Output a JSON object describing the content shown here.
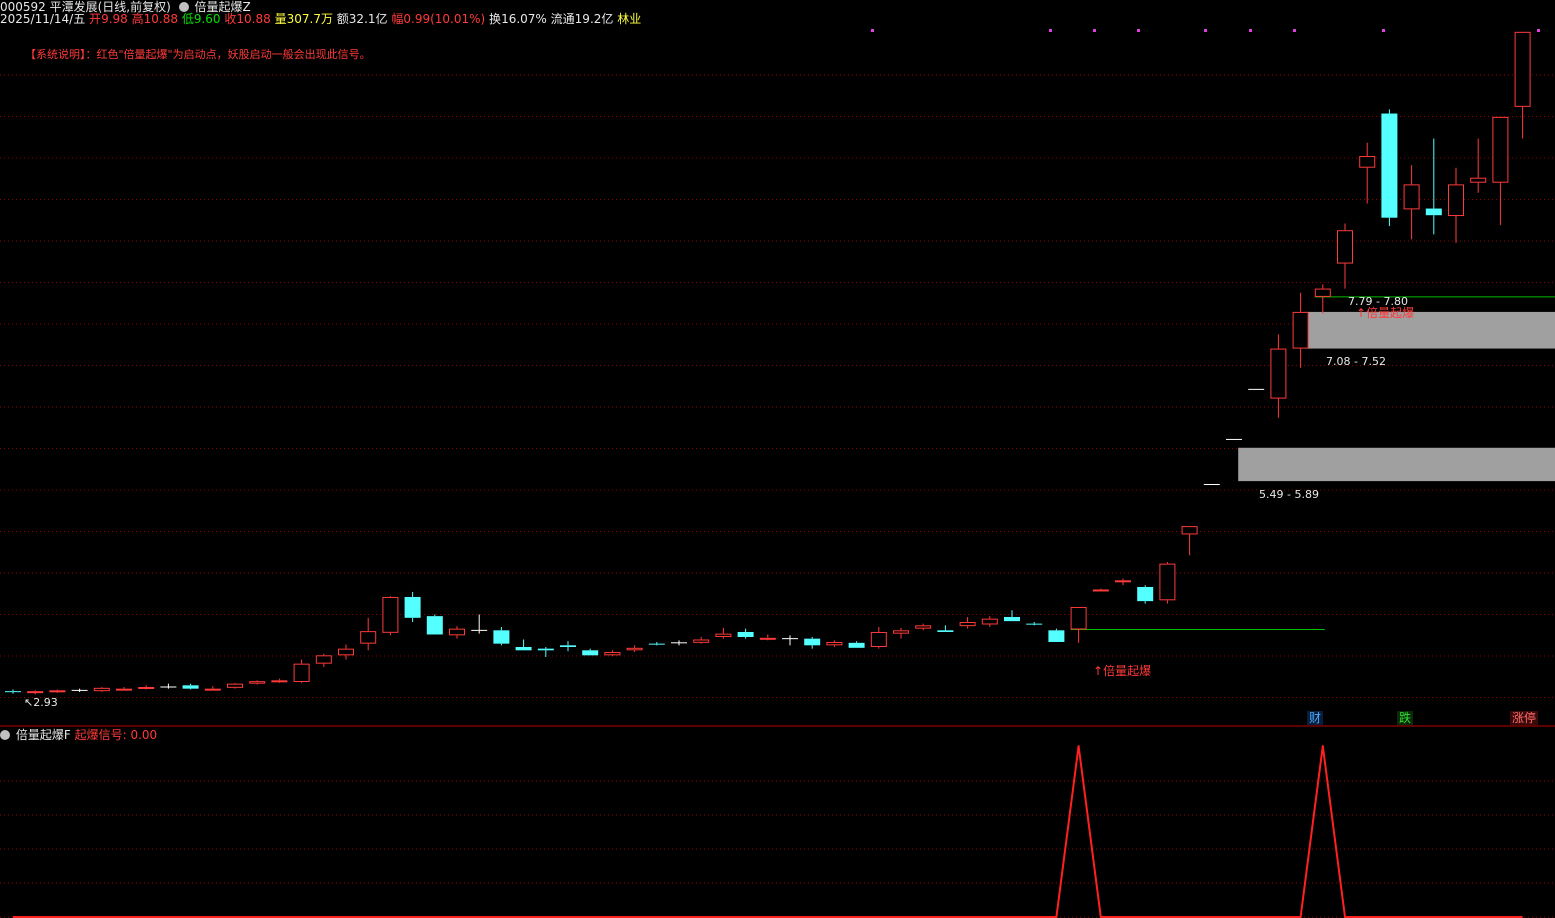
{
  "header": {
    "code_title": "000592 平潭发展(日线,前复权)",
    "indicator_name": "倍量起爆Z",
    "date": "2025/11/14/五",
    "open_label": "开",
    "open": "9.98",
    "high_label": "高",
    "high": "10.88",
    "low_label": "低",
    "low": "9.60",
    "close_label": "收",
    "close": "10.88",
    "vol_label": "量",
    "vol": "307.7万",
    "amt_label": "额",
    "amt": "32.1亿",
    "chg_label": "幅",
    "chg": "0.99(10.01%)",
    "turn_label": "换",
    "turn": "16.07%",
    "float_label": "流通",
    "float": "19.2亿",
    "industry": "林业"
  },
  "note": "【系统说明】：红色\"倍量起爆\"为启动点，妖股启动一般会出现此信号。",
  "labels": {
    "low_price": "2.93",
    "signal_a": "倍量起爆",
    "signal_b": "倍量起爆",
    "zone_top": "7.79 - 7.80",
    "zone_mid": "7.08 - 7.52",
    "zone_low": "5.49 - 5.89",
    "badge_cai": "财",
    "badge_die": "跌",
    "badge_zhang": "涨停"
  },
  "sub": {
    "name": "倍量起爆F",
    "series_label": "起爆信号:",
    "series_value": "0.00"
  },
  "colors": {
    "up": "#ff3a3a",
    "down": "#54ffff",
    "grid": "#8b0000",
    "zone": "#a0a0a0",
    "support": "#00c000"
  },
  "chart_data": [
    {
      "type": "candlestick",
      "candles": [
        [
          2.97,
          2.99,
          2.94,
          2.96
        ],
        [
          2.95,
          2.98,
          2.93,
          2.97
        ],
        [
          2.97,
          2.99,
          2.95,
          2.98
        ],
        [
          2.98,
          3.0,
          2.96,
          2.98
        ],
        [
          2.97,
          3.02,
          2.96,
          3.01
        ],
        [
          2.99,
          3.02,
          2.98,
          3.0
        ],
        [
          3.0,
          3.04,
          2.99,
          3.02
        ],
        [
          3.02,
          3.06,
          3.0,
          3.02
        ],
        [
          3.04,
          3.06,
          2.99,
          3.0
        ],
        [
          2.99,
          3.03,
          2.98,
          3.0
        ],
        [
          3.01,
          3.07,
          3.0,
          3.06
        ],
        [
          3.06,
          3.1,
          3.05,
          3.09
        ],
        [
          3.09,
          3.12,
          3.07,
          3.1
        ],
        [
          3.08,
          3.35,
          3.07,
          3.3
        ],
        [
          3.3,
          3.42,
          3.26,
          3.4
        ],
        [
          3.4,
          3.53,
          3.35,
          3.48
        ],
        [
          3.54,
          3.85,
          3.46,
          3.69
        ],
        [
          3.67,
          4.11,
          3.64,
          4.1
        ],
        [
          4.1,
          4.16,
          3.8,
          3.85
        ],
        [
          3.87,
          3.89,
          3.65,
          3.65
        ],
        [
          3.64,
          3.75,
          3.6,
          3.72
        ],
        [
          3.7,
          3.89,
          3.66,
          3.7
        ],
        [
          3.7,
          3.74,
          3.52,
          3.54
        ],
        [
          3.5,
          3.59,
          3.48,
          3.46
        ],
        [
          3.48,
          3.5,
          3.38,
          3.46
        ],
        [
          3.52,
          3.57,
          3.45,
          3.5
        ],
        [
          3.46,
          3.48,
          3.42,
          3.4
        ],
        [
          3.4,
          3.46,
          3.39,
          3.44
        ],
        [
          3.46,
          3.52,
          3.44,
          3.49
        ],
        [
          3.54,
          3.56,
          3.52,
          3.53
        ],
        [
          3.55,
          3.58,
          3.52,
          3.55
        ],
        [
          3.55,
          3.62,
          3.54,
          3.59
        ],
        [
          3.62,
          3.73,
          3.6,
          3.66
        ],
        [
          3.68,
          3.72,
          3.6,
          3.62
        ],
        [
          3.6,
          3.65,
          3.58,
          3.61
        ],
        [
          3.6,
          3.64,
          3.52,
          3.6
        ],
        [
          3.6,
          3.62,
          3.48,
          3.52
        ],
        [
          3.52,
          3.58,
          3.5,
          3.56
        ],
        [
          3.55,
          3.57,
          3.5,
          3.49
        ],
        [
          3.5,
          3.74,
          3.48,
          3.68
        ],
        [
          3.66,
          3.73,
          3.6,
          3.7
        ],
        [
          3.72,
          3.78,
          3.7,
          3.76
        ],
        [
          3.7,
          3.76,
          3.68,
          3.68
        ],
        [
          3.75,
          3.86,
          3.72,
          3.8
        ],
        [
          3.77,
          3.87,
          3.74,
          3.84
        ],
        [
          3.86,
          3.94,
          3.82,
          3.81
        ],
        [
          3.78,
          3.8,
          3.76,
          3.77
        ],
        [
          3.7,
          3.72,
          3.56,
          3.56
        ],
        [
          3.71,
          3.98,
          3.55,
          3.98
        ],
        [
          4.18,
          4.2,
          4.18,
          4.19
        ],
        [
          4.28,
          4.32,
          4.24,
          4.3
        ],
        [
          4.22,
          4.24,
          4.02,
          4.05
        ],
        [
          4.06,
          4.52,
          4.02,
          4.5
        ],
        [
          4.85,
          4.95,
          4.6,
          4.95
        ],
        [
          5.45,
          5.45,
          5.45,
          5.45
        ],
        [
          5.99,
          5.99,
          5.99,
          5.99
        ],
        [
          6.59,
          6.59,
          6.59,
          6.59
        ],
        [
          6.48,
          7.25,
          6.25,
          7.08
        ],
        [
          7.08,
          7.75,
          6.85,
          7.52
        ],
        [
          7.7,
          7.85,
          7.5,
          7.8
        ],
        [
          8.1,
          8.58,
          7.8,
          8.5
        ],
        [
          9.25,
          9.55,
          8.82,
          9.39
        ],
        [
          9.9,
          9.95,
          8.55,
          8.65
        ],
        [
          8.75,
          9.28,
          8.39,
          9.05
        ],
        [
          8.76,
          9.6,
          8.45,
          8.68
        ],
        [
          8.67,
          9.25,
          8.35,
          9.05
        ],
        [
          9.07,
          9.6,
          8.95,
          9.13
        ],
        [
          9.07,
          9.7,
          8.56,
          9.86
        ],
        [
          9.98,
          10.88,
          9.6,
          10.88
        ]
      ],
      "ylim": [
        2.72,
        10.95
      ],
      "signals": [
        48,
        59
      ],
      "zones": [
        [
          7.08,
          7.52
        ],
        [
          5.49,
          5.89
        ]
      ],
      "last_low": 2.93
    },
    {
      "type": "line",
      "name": "起爆信号",
      "values": [
        0,
        0,
        0,
        0,
        0,
        0,
        0,
        0,
        0,
        0,
        0,
        0,
        0,
        0,
        0,
        0,
        0,
        0,
        0,
        0,
        0,
        0,
        0,
        0,
        0,
        0,
        0,
        0,
        0,
        0,
        0,
        0,
        0,
        0,
        0,
        0,
        0,
        0,
        0,
        0,
        0,
        0,
        0,
        0,
        0,
        0,
        0,
        0,
        1,
        0,
        0,
        0,
        0,
        0,
        0,
        0,
        0,
        0,
        0,
        1,
        0,
        0,
        0,
        0,
        0,
        0,
        0,
        0,
        0
      ],
      "ylim": [
        0,
        1
      ]
    }
  ]
}
